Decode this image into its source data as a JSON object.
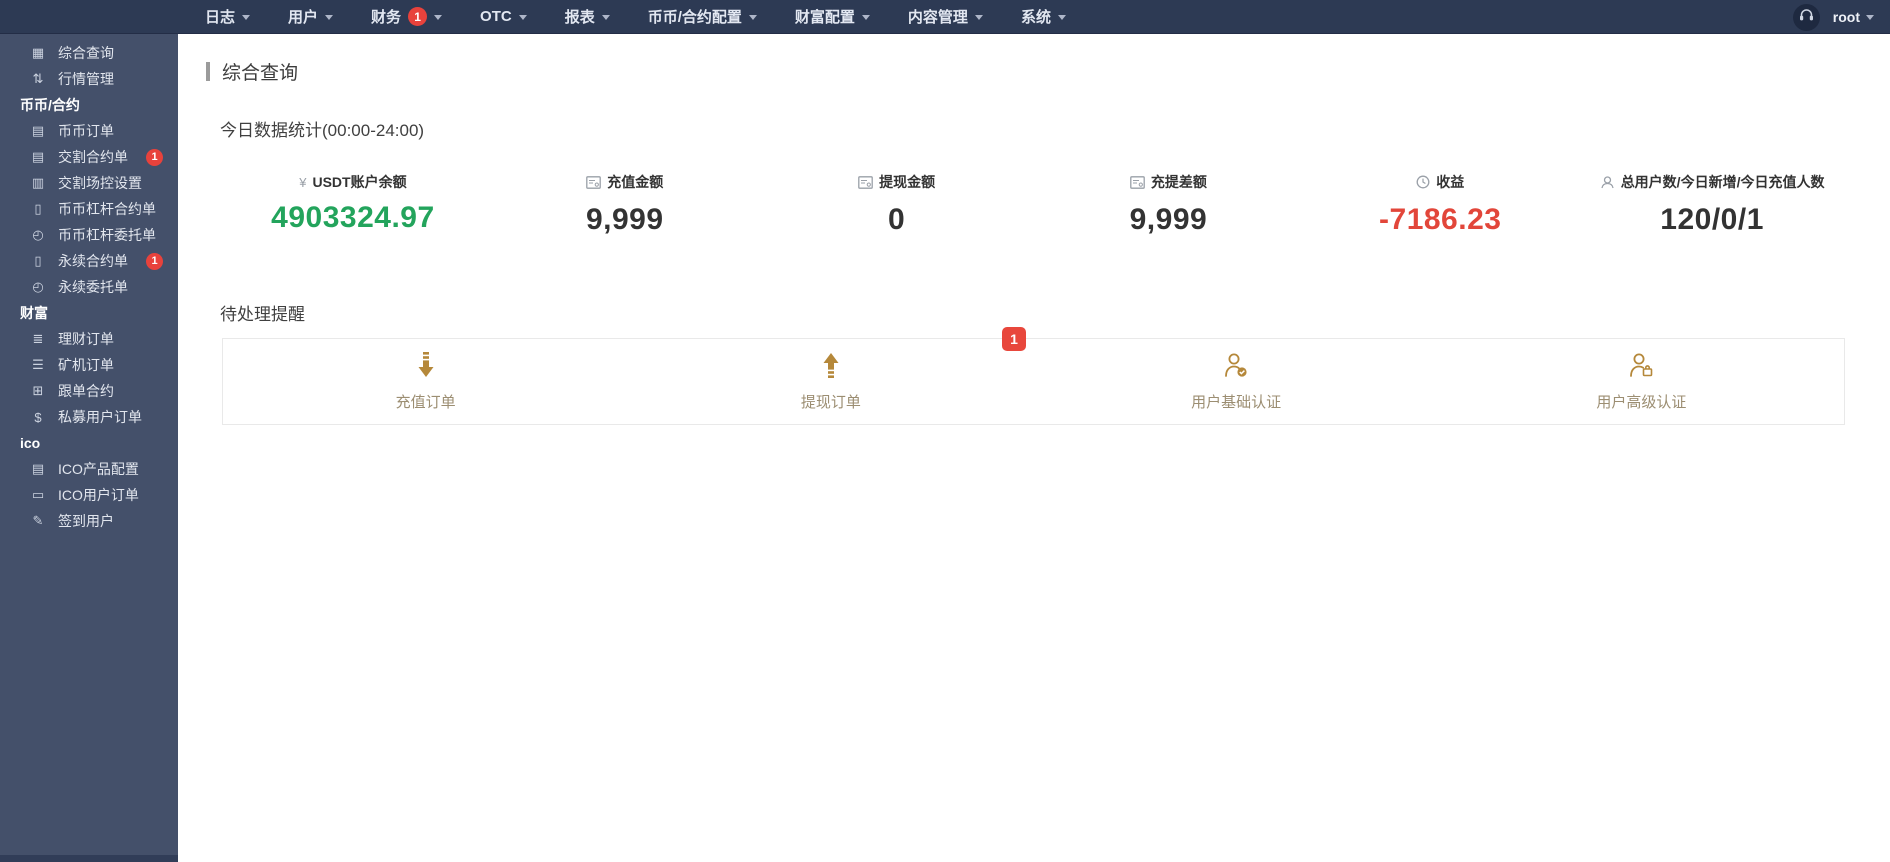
{
  "topbar": {
    "menus": [
      {
        "label": "日志"
      },
      {
        "label": "用户"
      },
      {
        "label": "财务",
        "badge": "1"
      },
      {
        "label": "OTC"
      },
      {
        "label": "报表"
      },
      {
        "label": "币币/合约配置"
      },
      {
        "label": "财富配置"
      },
      {
        "label": "内容管理"
      },
      {
        "label": "系统"
      }
    ],
    "username": "root"
  },
  "sidebar": {
    "items": [
      {
        "type": "item",
        "icon": "grid-icon",
        "glyph": "▦",
        "label": "综合查询"
      },
      {
        "type": "item",
        "icon": "market-sort-icon",
        "glyph": "⇅",
        "label": "行情管理"
      },
      {
        "type": "header",
        "label": "币币/合约"
      },
      {
        "type": "item",
        "icon": "bookmark-icon",
        "glyph": "▤",
        "label": "币币订单"
      },
      {
        "type": "item",
        "icon": "bookmark-icon",
        "glyph": "▤",
        "label": "交割合约单",
        "badge": "1"
      },
      {
        "type": "item",
        "icon": "clipboard-icon",
        "glyph": "▥",
        "label": "交割场控设置"
      },
      {
        "type": "item",
        "icon": "tablet-icon",
        "glyph": "▯",
        "label": "币币杠杆合约单"
      },
      {
        "type": "item",
        "icon": "calendar-clock-icon",
        "glyph": "◴",
        "label": "币币杠杆委托单"
      },
      {
        "type": "item",
        "icon": "tablet-icon",
        "glyph": "▯",
        "label": "永续合约单",
        "badge": "1"
      },
      {
        "type": "item",
        "icon": "calendar-clock-icon",
        "glyph": "◴",
        "label": "永续委托单"
      },
      {
        "type": "header",
        "label": "财富"
      },
      {
        "type": "item",
        "icon": "books-icon",
        "glyph": "≣",
        "label": "理财订单"
      },
      {
        "type": "item",
        "icon": "layers-icon",
        "glyph": "☰",
        "label": "矿机订单"
      },
      {
        "type": "item",
        "icon": "calendar-plus-icon",
        "glyph": "⊞",
        "label": "跟单合约"
      },
      {
        "type": "item",
        "icon": "dollar-icon",
        "glyph": "$",
        "label": "私募用户订单"
      },
      {
        "type": "header",
        "label": "ico"
      },
      {
        "type": "item",
        "icon": "file-edit-icon",
        "glyph": "▤",
        "label": "ICO产品配置"
      },
      {
        "type": "item",
        "icon": "monitor-icon",
        "glyph": "▭",
        "label": "ICO用户订单"
      },
      {
        "type": "item",
        "icon": "pen-check-icon",
        "glyph": "✎",
        "label": "签到用户"
      }
    ]
  },
  "page": {
    "title": "综合查询"
  },
  "stats_section": {
    "heading": "今日数据统计(00:00-24:00)",
    "stats": [
      {
        "label": "USDT账户余额",
        "value": "4903324.97",
        "color": "#23a45c",
        "glyph": "¥"
      },
      {
        "label": "充值金额",
        "value": "9,999",
        "color": "#333333"
      },
      {
        "label": "提现金额",
        "value": "0",
        "color": "#333333"
      },
      {
        "label": "充提差额",
        "value": "9,999",
        "color": "#333333"
      },
      {
        "label": "收益",
        "value": "-7186.23",
        "color": "#e2463a"
      },
      {
        "label": "总用户数/今日新增/今日充值人数",
        "value": "120/0/1",
        "color": "#333333"
      }
    ]
  },
  "reminder_section": {
    "heading": "待处理提醒",
    "items": [
      {
        "label": "充值订单"
      },
      {
        "label": "提现订单",
        "badge": "1"
      },
      {
        "label": "用户基础认证"
      },
      {
        "label": "用户高级认证"
      }
    ]
  },
  "colors": {
    "accent_gold": "#b5883a",
    "badge_red": "#e8423c",
    "positive_green": "#23a45c",
    "negative_red": "#e2463a",
    "sidebar_bg": "#44506a",
    "topbar_bg": "#2d3a54"
  }
}
